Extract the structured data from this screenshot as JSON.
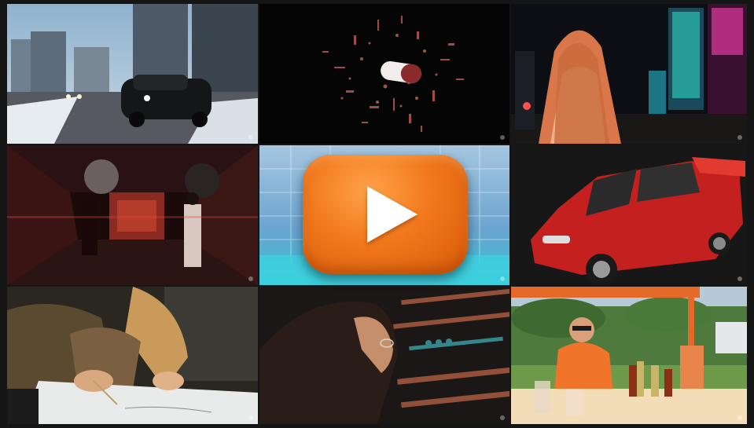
{
  "colors": {
    "page_background": "#151515",
    "play_button": "#f2781c",
    "play_icon": "#ffffff"
  },
  "thumbnails": [
    {
      "subject": "city-street-car"
    },
    {
      "subject": "exploding-pill"
    },
    {
      "subject": "woman-neon-city"
    },
    {
      "subject": "red-lit-tram-interior"
    },
    {
      "subject": "blue-glass-building"
    },
    {
      "subject": "red-hatchback-car"
    },
    {
      "subject": "woman-drawing"
    },
    {
      "subject": "woman-glasses-neon"
    },
    {
      "subject": "lemonade-stand-man"
    }
  ],
  "play_button": {
    "icon": "play-icon"
  }
}
